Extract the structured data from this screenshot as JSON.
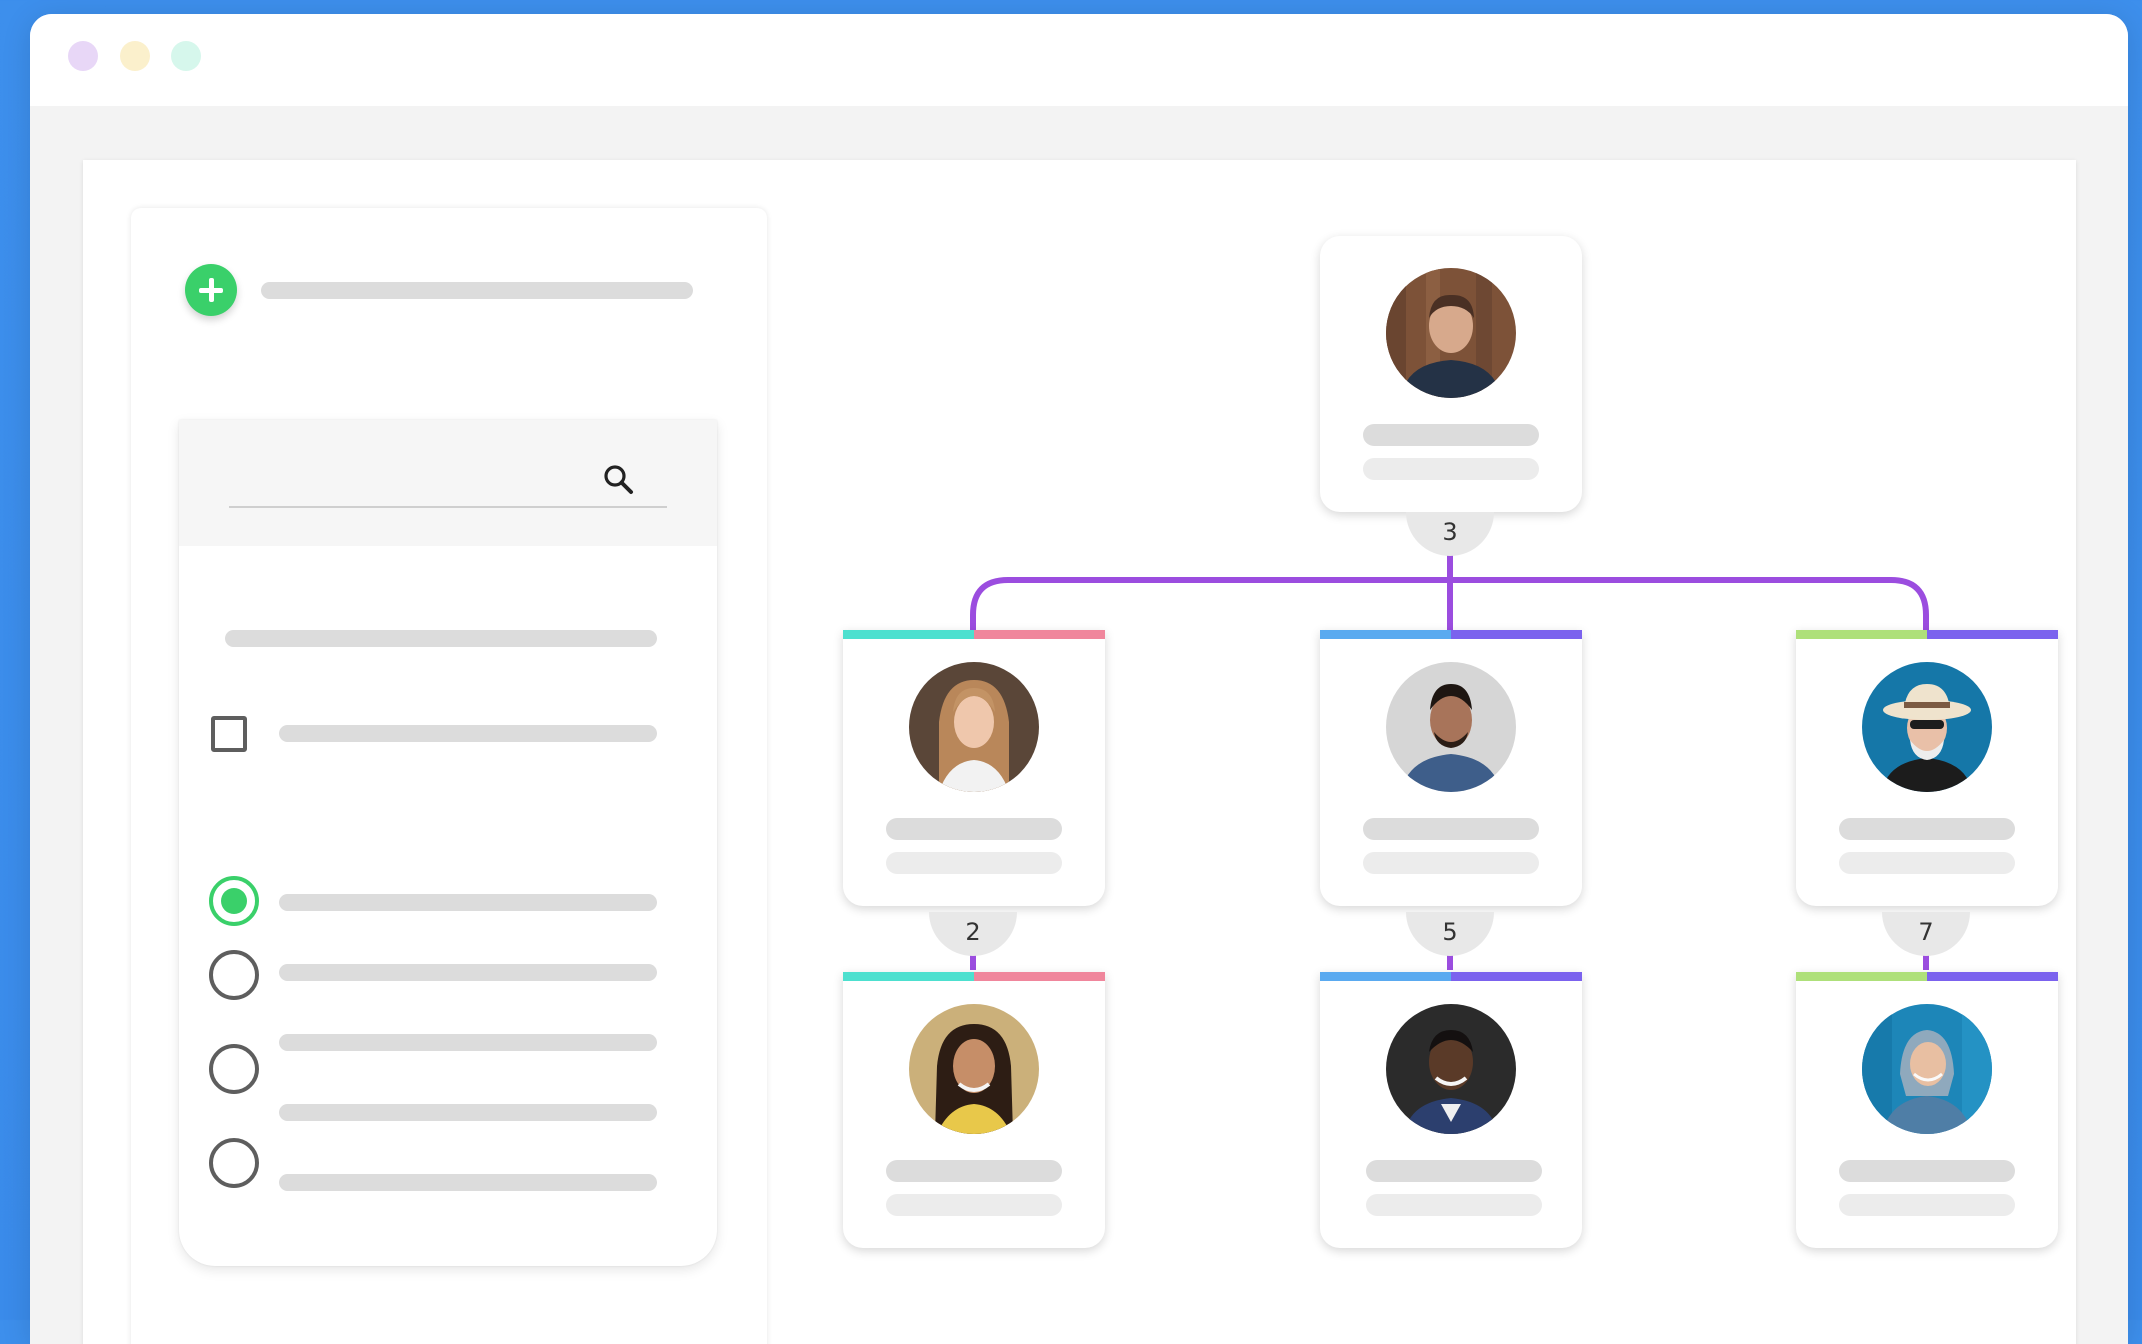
{
  "window": {
    "controls": [
      {
        "name": "close",
        "color": "#e8d7f7"
      },
      {
        "name": "minimize",
        "color": "#fbf0cc"
      },
      {
        "name": "maximize",
        "color": "#d6f7ec"
      }
    ]
  },
  "sidebar": {
    "add_icon": "plus-icon",
    "search": {
      "value": "",
      "placeholder": "",
      "icon": "search-icon"
    },
    "checkbox": {
      "checked": false
    },
    "radio_options": [
      {
        "checked": true
      },
      {
        "checked": false
      },
      {
        "checked": false
      },
      {
        "checked": false
      }
    ]
  },
  "org_chart": {
    "connector_color": "#9b4ddf",
    "root": {
      "report_count": "3"
    },
    "managers": [
      {
        "report_count": "2",
        "accent_colors": [
          "#4de0cf",
          "#f0869c"
        ]
      },
      {
        "report_count": "5",
        "accent_colors": [
          "#5aaaf0",
          "#7b62ee"
        ]
      },
      {
        "report_count": "7",
        "accent_colors": [
          "#aee07a",
          "#7b62ee"
        ]
      }
    ]
  }
}
